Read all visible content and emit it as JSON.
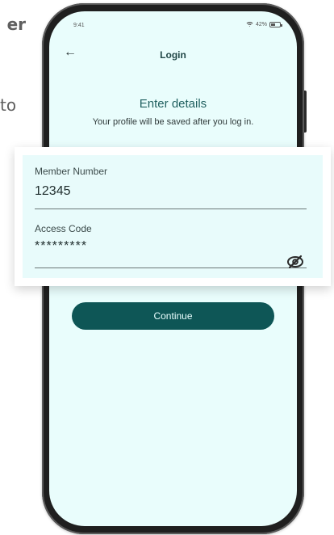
{
  "background_text": {
    "top": "er",
    "middle": "to"
  },
  "status_bar": {
    "time": "9:41",
    "battery_percent": "42%"
  },
  "header": {
    "title": "Login"
  },
  "intro": {
    "title": "Enter details",
    "subtitle": "Your profile will be saved after you log in."
  },
  "form": {
    "member_number_label": "Member Number",
    "member_number_value": "12345",
    "access_code_label": "Access Code",
    "access_code_value": "*********"
  },
  "continue_button": {
    "label": "Continue"
  },
  "colors": {
    "screen_bg": "#e9fdfc",
    "primary_button": "#0e5656",
    "title_text": "#214747"
  }
}
